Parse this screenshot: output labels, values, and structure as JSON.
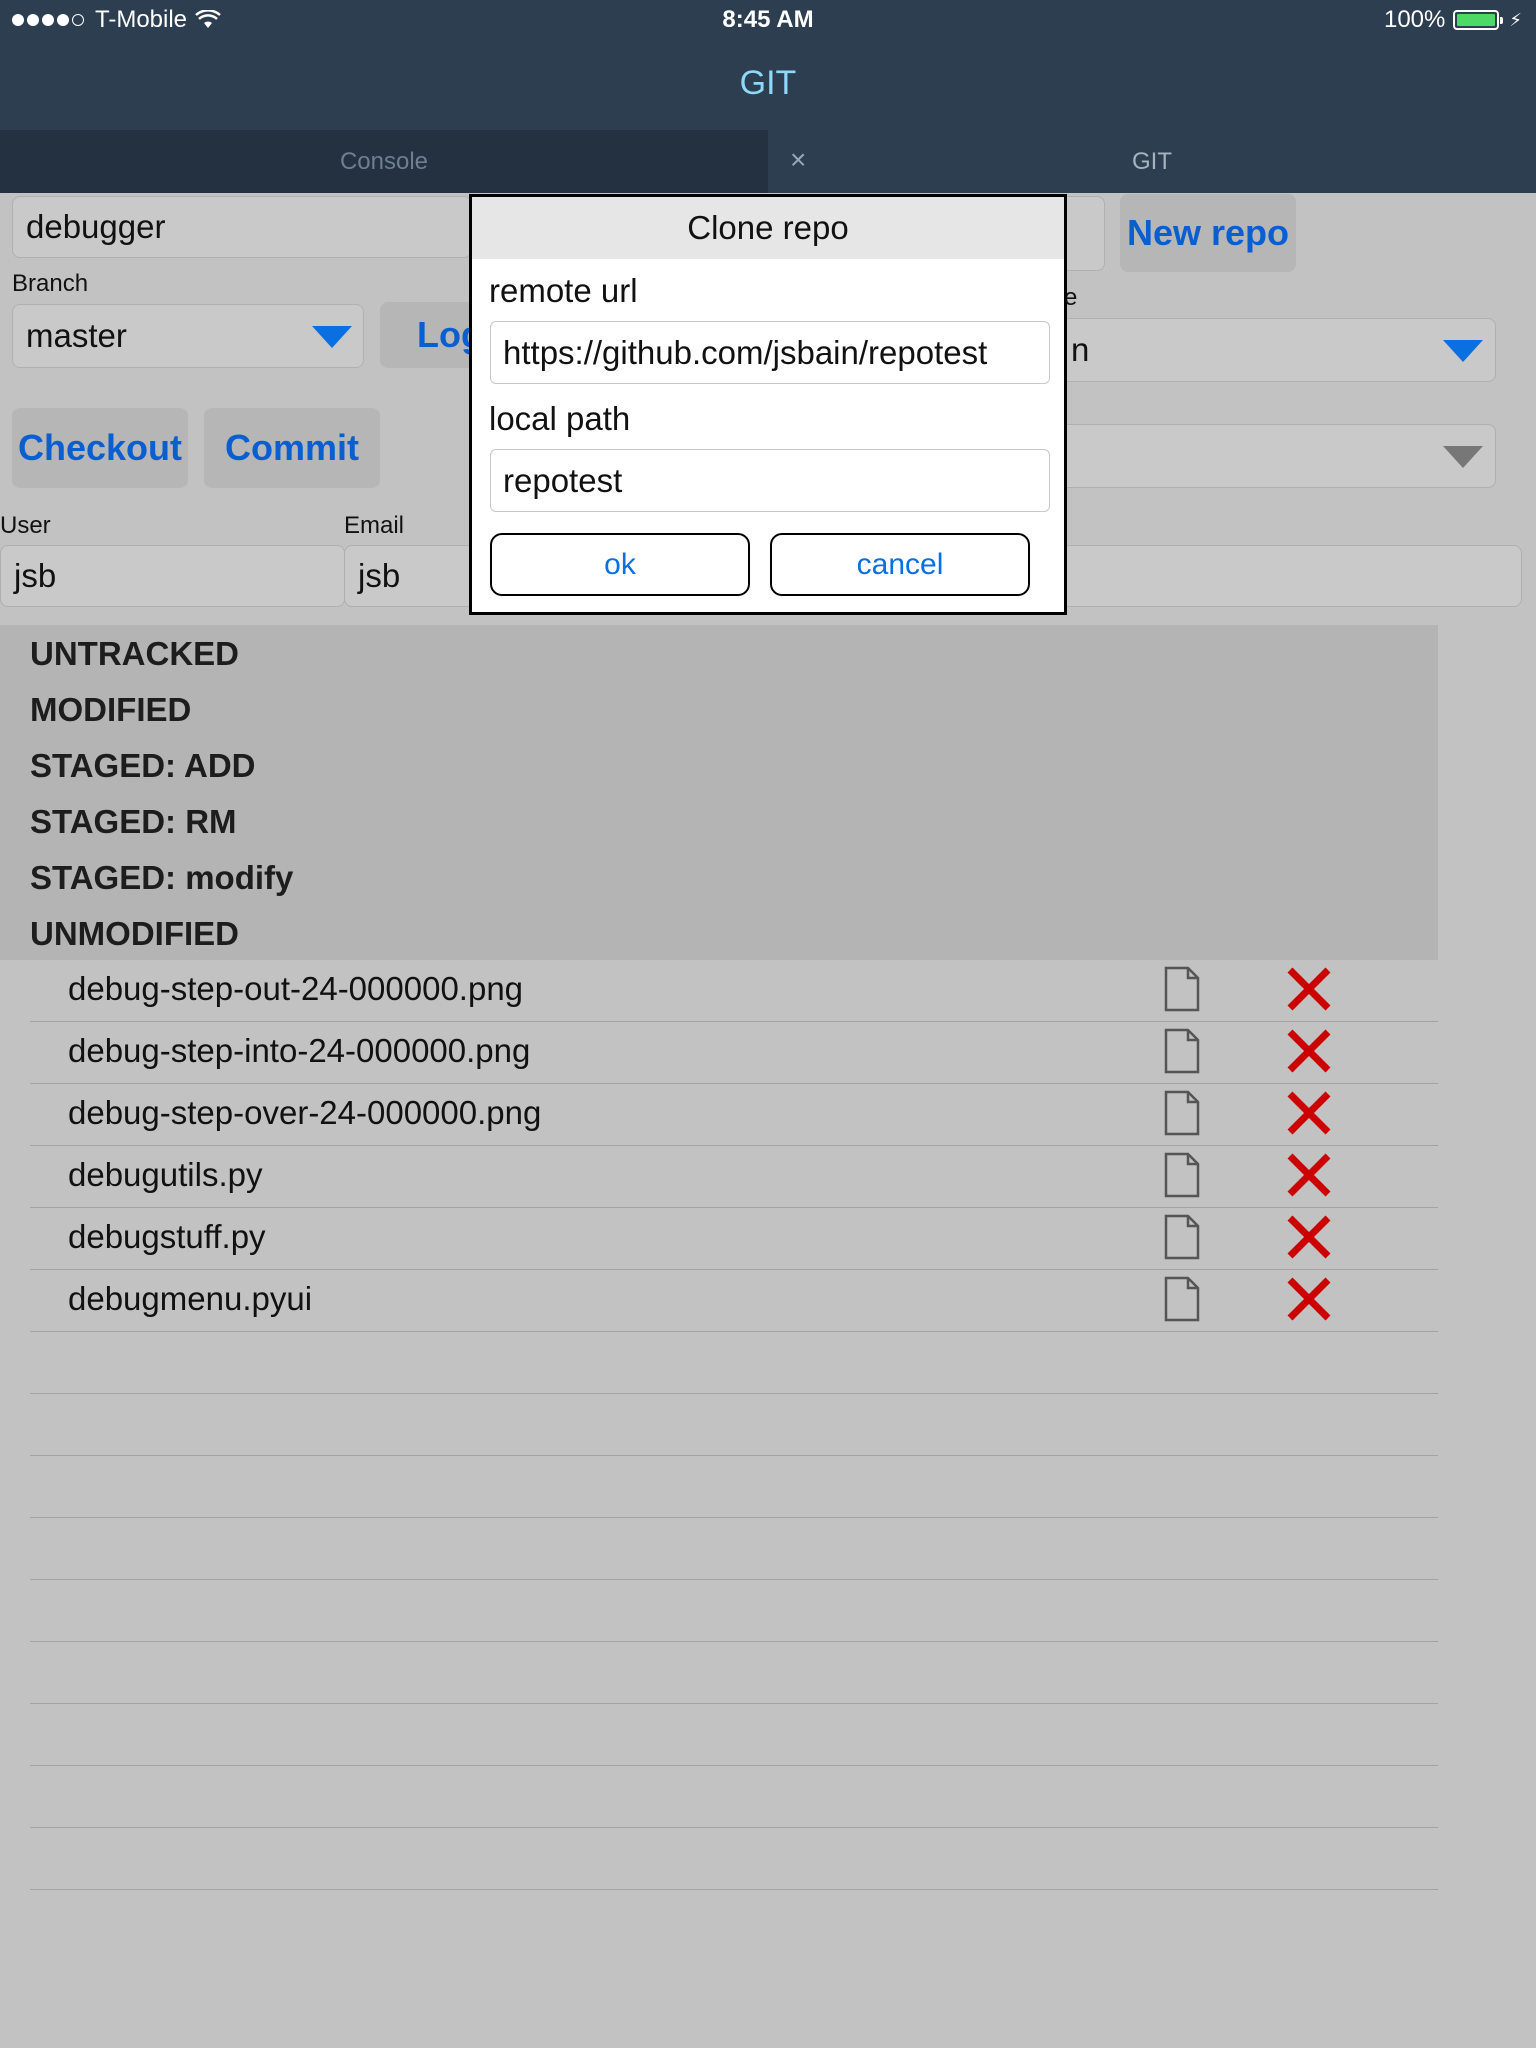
{
  "status_bar": {
    "carrier": "T-Mobile",
    "signal_bars_filled": 4,
    "signal_bars_total": 5,
    "time": "8:45 AM",
    "battery": "100%",
    "battery_color": "#4cd964"
  },
  "nav": {
    "title": "GIT"
  },
  "tabs": [
    {
      "label": "Console"
    },
    {
      "label": "GIT"
    }
  ],
  "tab_close": "×",
  "repo": {
    "name": "debugger",
    "new_repo_label": "New repo"
  },
  "branch": {
    "label": "Branch",
    "value": "master",
    "log_label": "Log"
  },
  "remote": {
    "label_fragment": "e",
    "value_fragment": "n"
  },
  "actions": {
    "checkout_label": "Checkout",
    "commit_label": "Commit"
  },
  "user": {
    "label": "User",
    "value": "jsb"
  },
  "email": {
    "label": "Email",
    "value": "jsb"
  },
  "sections": [
    "UNTRACKED",
    "MODIFIED",
    "STAGED: ADD",
    "STAGED: RM",
    "STAGED: modify",
    "UNMODIFIED"
  ],
  "files": [
    "debug-step-out-24-000000.png",
    "debug-step-into-24-000000.png",
    "debug-step-over-24-000000.png",
    "debugutils.py",
    "debugstuff.py",
    "debugmenu.pyui"
  ],
  "dialog": {
    "title": "Clone repo",
    "remote_url_label": "remote url",
    "remote_url_value": "https://github.com/jsbain/repotest",
    "local_path_label": "local path",
    "local_path_value": "repotest",
    "ok_label": "ok",
    "cancel_label": "cancel"
  },
  "colors": {
    "bar_bg": "#2c3e50",
    "accent_blue": "#0a5fd0",
    "delete_red": "#cc0000",
    "nav_title": "#8ed8f8"
  }
}
